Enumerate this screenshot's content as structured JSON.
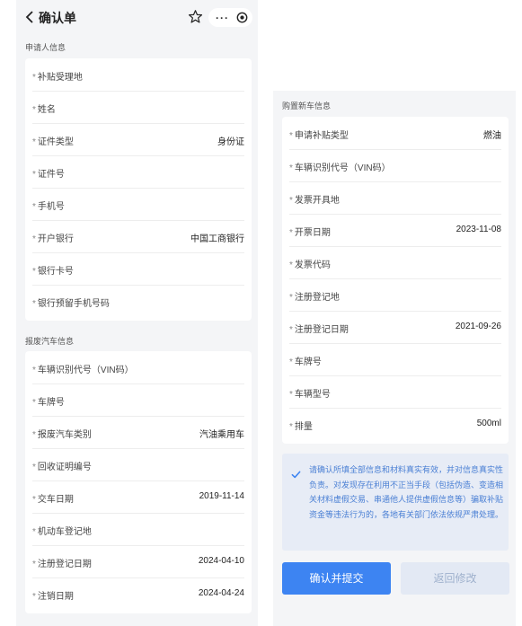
{
  "header": {
    "title": "确认单",
    "more_label": "···"
  },
  "applicant": {
    "section_title": "申请人信息",
    "fields": [
      {
        "label": "补贴受理地",
        "value": ""
      },
      {
        "label": "姓名",
        "value": ""
      },
      {
        "label": "证件类型",
        "value": "身份证"
      },
      {
        "label": "证件号",
        "value": ""
      },
      {
        "label": "手机号",
        "value": ""
      },
      {
        "label": "开户银行",
        "value": "中国工商银行"
      },
      {
        "label": "银行卡号",
        "value": ""
      },
      {
        "label": "银行预留手机号码",
        "value": ""
      }
    ]
  },
  "scrap_car": {
    "section_title": "报废汽车信息",
    "fields": [
      {
        "label": "车辆识别代号（VIN码）",
        "value": ""
      },
      {
        "label": "车牌号",
        "value": ""
      },
      {
        "label": "报废汽车类别",
        "value": "汽油乘用车"
      },
      {
        "label": "回收证明编号",
        "value": ""
      },
      {
        "label": "交车日期",
        "value": "2019-11-14"
      },
      {
        "label": "机动车登记地",
        "value": ""
      },
      {
        "label": "注册登记日期",
        "value": "2024-04-10"
      },
      {
        "label": "注销日期",
        "value": "2024-04-24"
      }
    ]
  },
  "new_car": {
    "section_title": "购置新车信息",
    "fields": [
      {
        "label": "申请补贴类型",
        "value": "燃油"
      },
      {
        "label": "车辆识别代号（VIN码）",
        "value": ""
      },
      {
        "label": "发票开具地",
        "value": ""
      },
      {
        "label": "开票日期",
        "value": "2023-11-08"
      },
      {
        "label": "发票代码",
        "value": ""
      },
      {
        "label": "注册登记地",
        "value": ""
      },
      {
        "label": "注册登记日期",
        "value": "2021-09-26"
      },
      {
        "label": "车牌号",
        "value": ""
      },
      {
        "label": "车辆型号",
        "value": ""
      },
      {
        "label": "排量",
        "value": "500ml"
      }
    ]
  },
  "notice": {
    "checked": true,
    "text": "请确认所填全部信息和材料真实有效，并对信息真实性负责。对发现存在利用不正当手段（包括伪造、变造相关材料虚假交易、串通他人提供虚假信息等）骗取补贴资金等违法行为的，各地有关部门依法依规严肃处理。"
  },
  "actions": {
    "confirm_label": "确认并提交",
    "back_label": "返回修改"
  },
  "colors": {
    "accent": "#3d84f2",
    "panel_bg": "#f4f5f7",
    "notice_bg": "#e7ecf6",
    "notice_text": "#4a7fd4"
  }
}
